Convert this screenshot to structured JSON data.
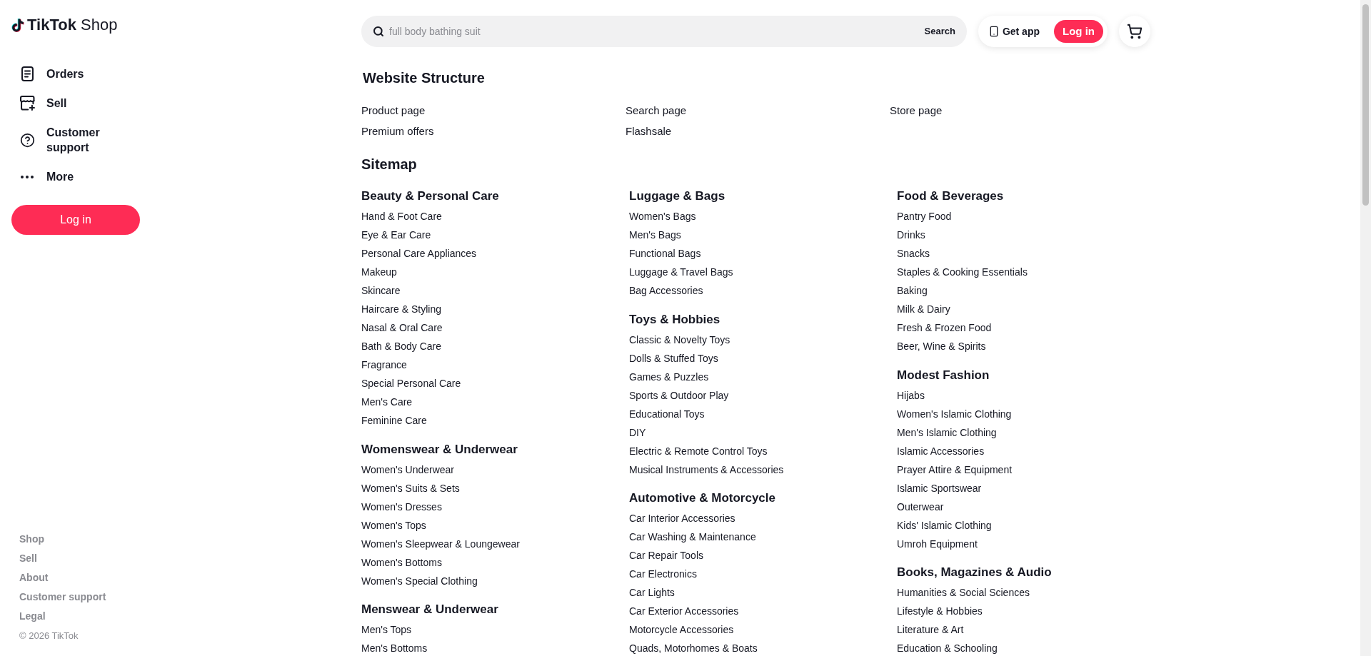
{
  "sidebar": {
    "logo": "**TikTok** Shop",
    "nav": [
      {
        "label": "Orders",
        "kind": "orders"
      },
      {
        "label": "Sell",
        "kind": "sell"
      },
      {
        "label": "Customer support",
        "kind": "support"
      },
      {
        "label": "More",
        "kind": "more"
      }
    ],
    "login_button": "Log in",
    "footer_links": [
      "Shop",
      "Sell",
      "About",
      "Customer support",
      "Legal"
    ],
    "copyright": "© 2026 TikTok"
  },
  "header": {
    "search": {
      "placeholder": "full body bathing suit",
      "button": "Search"
    },
    "get_app": "Get app",
    "login_button": "Log in"
  },
  "website_structure": {
    "title": "Website Structure",
    "links": [
      "Product page",
      "Search page",
      "Store page",
      "Premium offers",
      "Flashsale"
    ]
  },
  "sitemap": {
    "title": "Sitemap",
    "columns": [
      {
        "groups": [
          {
            "title": "Beauty & Personal Care",
            "items": [
              "Hand & Foot Care",
              "Eye & Ear Care",
              "Personal Care Appliances",
              "Makeup",
              "Skincare",
              "Haircare & Styling",
              "Nasal & Oral Care",
              "Bath & Body Care",
              "Fragrance",
              "Special Personal Care",
              "Men's Care",
              "Feminine Care"
            ]
          },
          {
            "title": "Womenswear & Underwear",
            "items": [
              "Women's Underwear",
              "Women's Suits & Sets",
              "Women's Dresses",
              "Women's Tops",
              "Women's Sleepwear & Loungewear",
              "Women's Bottoms",
              "Women's Special Clothing"
            ]
          },
          {
            "title": "Menswear & Underwear",
            "items": [
              "Men's Tops",
              "Men's Bottoms"
            ]
          }
        ]
      },
      {
        "groups": [
          {
            "title": "Luggage & Bags",
            "items": [
              "Women's Bags",
              "Men's Bags",
              "Functional Bags",
              "Luggage & Travel Bags",
              "Bag Accessories"
            ]
          },
          {
            "title": "Toys & Hobbies",
            "items": [
              "Classic & Novelty Toys",
              "Dolls & Stuffed Toys",
              "Games & Puzzles",
              "Sports & Outdoor Play",
              "Educational Toys",
              "DIY",
              "Electric & Remote Control Toys",
              "Musical Instruments & Accessories"
            ]
          },
          {
            "title": "Automotive & Motorcycle",
            "items": [
              "Car Interior Accessories",
              "Car Washing & Maintenance",
              "Car Repair Tools",
              "Car Electronics",
              "Car Lights",
              "Car Exterior Accessories",
              "Motorcycle Accessories",
              "Quads, Motorhomes & Boats"
            ]
          }
        ]
      },
      {
        "groups": [
          {
            "title": "Food & Beverages",
            "items": [
              "Pantry Food",
              "Drinks",
              "Snacks",
              "Staples & Cooking Essentials",
              "Baking",
              "Milk & Dairy",
              "Fresh & Frozen Food",
              "Beer, Wine & Spirits"
            ]
          },
          {
            "title": "Modest Fashion",
            "items": [
              "Hijabs",
              "Women's Islamic Clothing",
              "Men's Islamic Clothing",
              "Islamic Accessories",
              "Prayer Attire & Equipment",
              "Islamic Sportswear",
              "Outerwear",
              "Kids' Islamic Clothing",
              "Umroh Equipment"
            ]
          },
          {
            "title": "Books, Magazines & Audio",
            "items": [
              "Humanities & Social Sciences",
              "Lifestyle & Hobbies",
              "Literature & Art",
              "Education & Schooling"
            ]
          }
        ]
      }
    ]
  }
}
